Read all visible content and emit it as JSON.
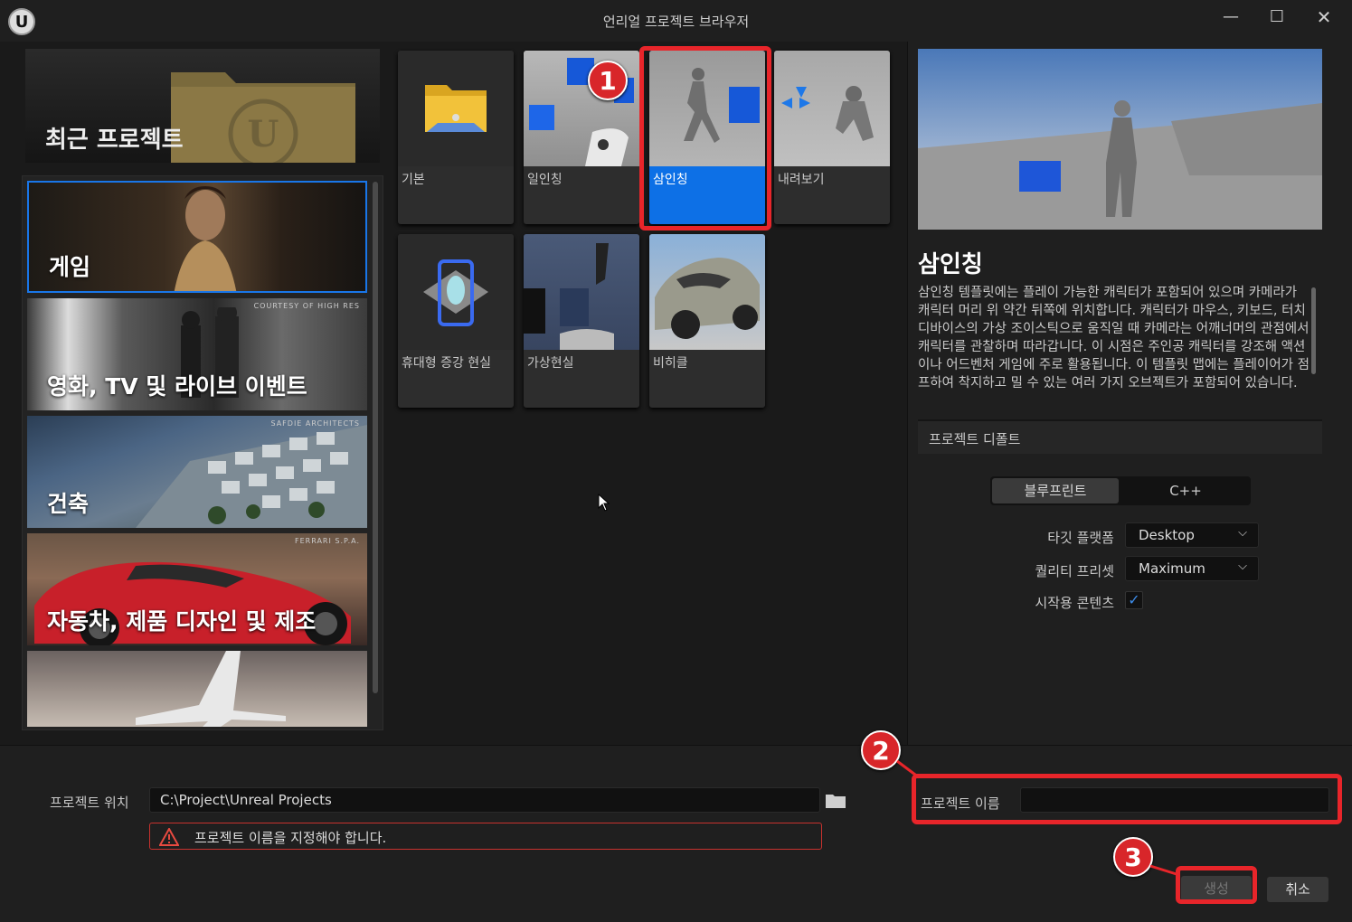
{
  "window": {
    "title": "언리얼 프로젝트 브라우저",
    "controls": {
      "minimize": "—",
      "maximize": "☐",
      "close": "✕"
    }
  },
  "sidebar": {
    "recent_label": "최근 프로젝트",
    "categories": [
      {
        "label": "게임",
        "credit": "",
        "selected": true
      },
      {
        "label": "영화, TV 및 라이브 이벤트",
        "credit": "COURTESY OF HIGH RES"
      },
      {
        "label": "건축",
        "credit": "SAFDIE ARCHITECTS"
      },
      {
        "label": "자동차, 제품 디자인 및 제조",
        "credit": "FERRARI S.P.A."
      },
      {
        "label": "",
        "credit": ""
      }
    ]
  },
  "templates": [
    {
      "label": "기본",
      "selected": false
    },
    {
      "label": "일인칭",
      "selected": false
    },
    {
      "label": "삼인칭",
      "selected": true
    },
    {
      "label": "내려보기",
      "selected": false
    },
    {
      "label": "휴대형 증강 현실",
      "selected": false
    },
    {
      "label": "가상현실",
      "selected": false
    },
    {
      "label": "비히클",
      "selected": false
    }
  ],
  "details": {
    "title": "삼인칭",
    "description": "삼인칭 템플릿에는 플레이 가능한 캐릭터가 포함되어 있으며 카메라가 캐릭터 머리 위 약간 뒤쪽에 위치합니다. 캐릭터가 마우스, 키보드, 터치 디바이스의 가상 조이스틱으로 움직일 때 카메라는 어깨너머의 관점에서 캐릭터를 관찰하며 따라갑니다. 이 시점은 주인공 캐릭터를 강조해 액션이나 어드벤처 게임에 주로 활용됩니다. 이 템플릿 맵에는 플레이어가 점프하여 착지하고 밀 수 있는 여러 가지 오브젝트가 포함되어 있습니다.",
    "defaults_header": "프로젝트 디폴트",
    "language_options": [
      "블루프린트",
      "C++"
    ],
    "language_selected": "블루프린트",
    "target_platform_label": "타깃 플랫폼",
    "target_platform_value": "Desktop",
    "quality_preset_label": "퀄리티 프리셋",
    "quality_preset_value": "Maximum",
    "starter_content_label": "시작용 콘텐츠",
    "starter_content_checked": true
  },
  "footer": {
    "location_label": "프로젝트 위치",
    "location_value": "C:\\Project\\Unreal Projects",
    "error_message": "프로젝트 이름을 지정해야 합니다.",
    "name_label": "프로젝트 이름",
    "name_value": "",
    "create_label": "생성",
    "cancel_label": "취소"
  },
  "annotations": {
    "badge1": "1",
    "badge2": "2",
    "badge3": "3"
  },
  "colors": {
    "accent": "#0d70e6",
    "highlight": "#e8252a",
    "error_border": "#c8322e"
  }
}
